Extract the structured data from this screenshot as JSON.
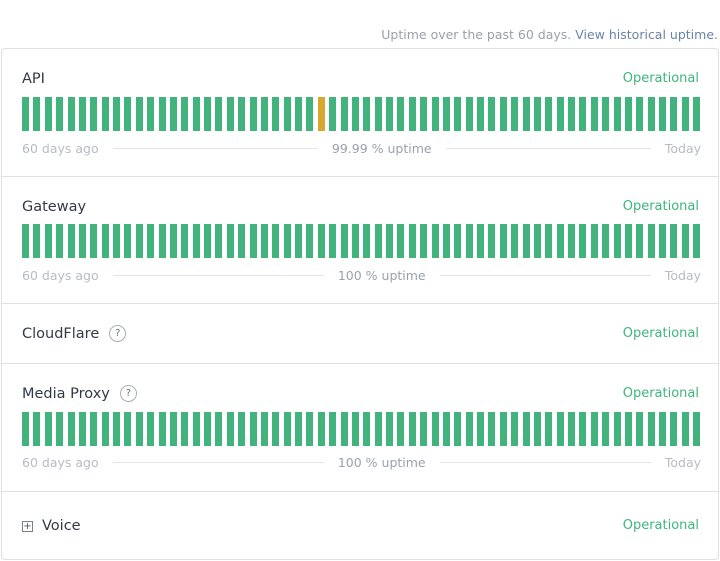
{
  "header": {
    "uptime_note": "Uptime over the past 60 days.",
    "historical_link": "View historical uptime."
  },
  "colors": {
    "operational": "#3fb57e",
    "bar_up": "#43b37e",
    "bar_degraded": "#d7a82e"
  },
  "legend": {
    "start_label": "60 days ago",
    "end_label": "Today"
  },
  "components": {
    "api": {
      "name": "API",
      "status": "Operational",
      "uptime_label": "99.99 % uptime",
      "days": [
        "up",
        "up",
        "up",
        "up",
        "up",
        "up",
        "up",
        "up",
        "up",
        "up",
        "up",
        "up",
        "up",
        "up",
        "up",
        "up",
        "up",
        "up",
        "up",
        "up",
        "up",
        "up",
        "up",
        "up",
        "up",
        "up",
        "degraded",
        "up",
        "up",
        "up",
        "up",
        "up",
        "up",
        "up",
        "up",
        "up",
        "up",
        "up",
        "up",
        "up",
        "up",
        "up",
        "up",
        "up",
        "up",
        "up",
        "up",
        "up",
        "up",
        "up",
        "up",
        "up",
        "up",
        "up",
        "up",
        "up",
        "up",
        "up",
        "up",
        "up"
      ]
    },
    "gateway": {
      "name": "Gateway",
      "status": "Operational",
      "uptime_label": "100 % uptime",
      "days": [
        "up",
        "up",
        "up",
        "up",
        "up",
        "up",
        "up",
        "up",
        "up",
        "up",
        "up",
        "up",
        "up",
        "up",
        "up",
        "up",
        "up",
        "up",
        "up",
        "up",
        "up",
        "up",
        "up",
        "up",
        "up",
        "up",
        "up",
        "up",
        "up",
        "up",
        "up",
        "up",
        "up",
        "up",
        "up",
        "up",
        "up",
        "up",
        "up",
        "up",
        "up",
        "up",
        "up",
        "up",
        "up",
        "up",
        "up",
        "up",
        "up",
        "up",
        "up",
        "up",
        "up",
        "up",
        "up",
        "up",
        "up",
        "up",
        "up",
        "up"
      ]
    },
    "cloudflare": {
      "name": "CloudFlare",
      "status": "Operational",
      "help_icon": "question-circle-icon",
      "help_glyph": "?"
    },
    "media_proxy": {
      "name": "Media Proxy",
      "status": "Operational",
      "help_icon": "question-circle-icon",
      "help_glyph": "?",
      "uptime_label": "100 % uptime",
      "days": [
        "up",
        "up",
        "up",
        "up",
        "up",
        "up",
        "up",
        "up",
        "up",
        "up",
        "up",
        "up",
        "up",
        "up",
        "up",
        "up",
        "up",
        "up",
        "up",
        "up",
        "up",
        "up",
        "up",
        "up",
        "up",
        "up",
        "up",
        "up",
        "up",
        "up",
        "up",
        "up",
        "up",
        "up",
        "up",
        "up",
        "up",
        "up",
        "up",
        "up",
        "up",
        "up",
        "up",
        "up",
        "up",
        "up",
        "up",
        "up",
        "up",
        "up",
        "up",
        "up",
        "up",
        "up",
        "up",
        "up",
        "up",
        "up",
        "up",
        "up"
      ]
    },
    "voice": {
      "name": "Voice",
      "status": "Operational",
      "expand_icon": "plus-square-icon",
      "expand_glyph": "+"
    }
  }
}
